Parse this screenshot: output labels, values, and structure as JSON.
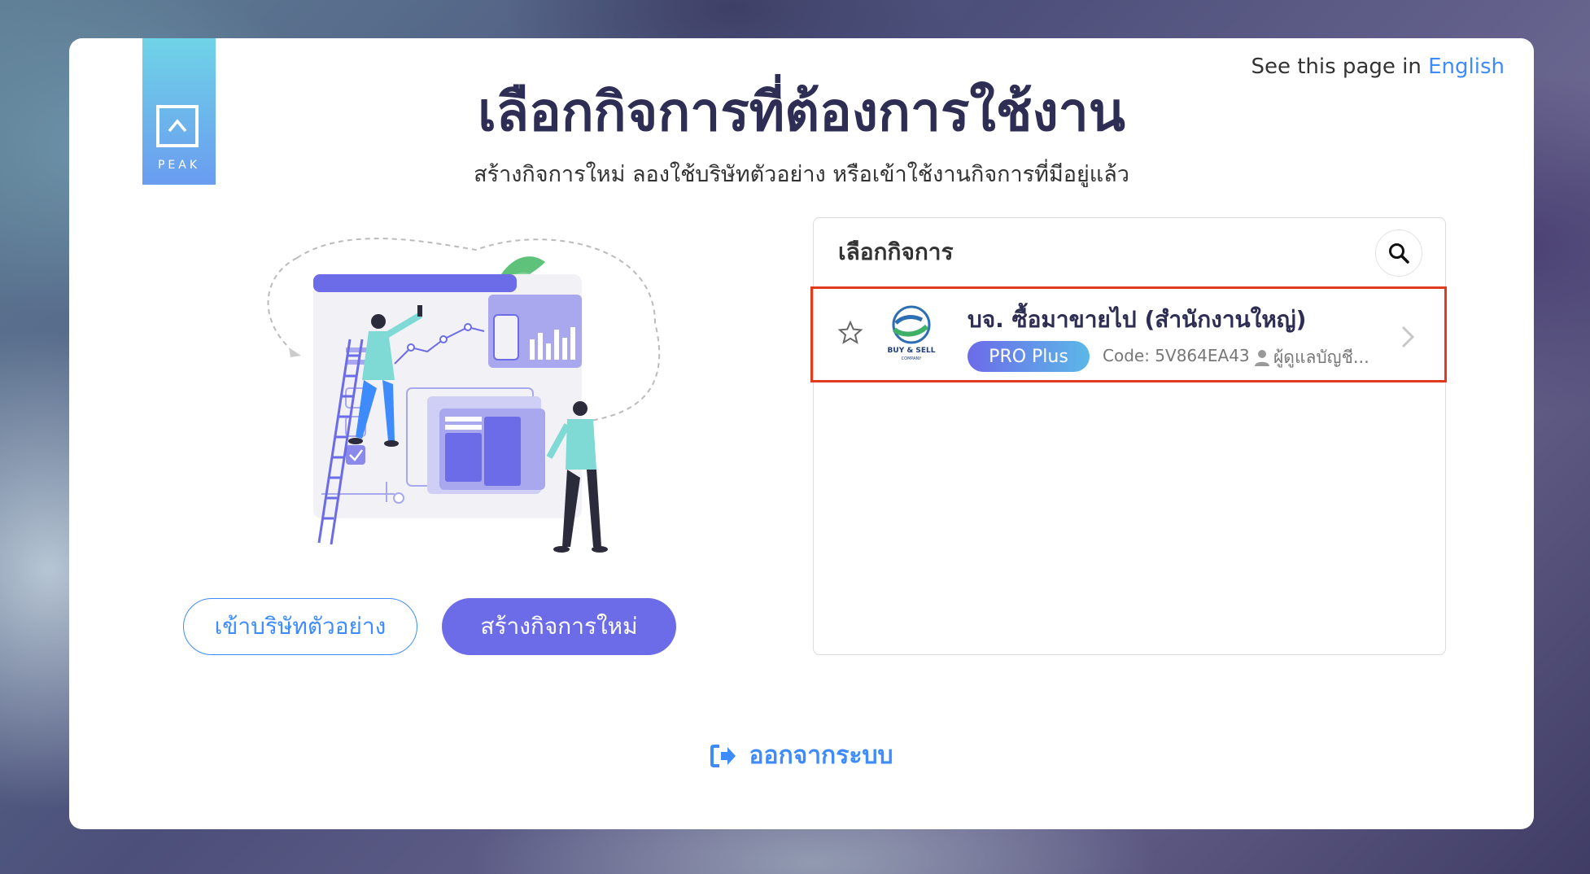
{
  "header": {
    "logo_text": "PEAK",
    "lang_prefix": "See this page in",
    "lang_link": "English",
    "title": "เลือกกิจการที่ต้องการใช้งาน",
    "subtitle": "สร้างกิจการใหม่ ลองใช้บริษัทตัวอย่าง หรือเข้าใช้งานกิจการที่มีอยู่แล้ว"
  },
  "actions": {
    "demo_label": "เข้าบริษัทตัวอย่าง",
    "create_label": "สร้างกิจการใหม่"
  },
  "business_panel": {
    "title": "เลือกกิจการ",
    "search_icon": "search-icon",
    "items": [
      {
        "name": "บจ. ซื้อมาขายไป (สำนักงานใหญ่)",
        "logo_text": "BUY & SELL",
        "logo_subtext": "COMPANY",
        "plan": "PRO Plus",
        "code": "Code: 5V864EA43",
        "role": "ผู้ดูแลบัญชี...",
        "favorite": false
      }
    ]
  },
  "footer": {
    "logout_label": "ออกจากระบบ"
  },
  "colors": {
    "primary": "#6c6be8",
    "link": "#3d8bfd",
    "highlight_border": "#e03a1f",
    "title": "#2e2e55"
  }
}
